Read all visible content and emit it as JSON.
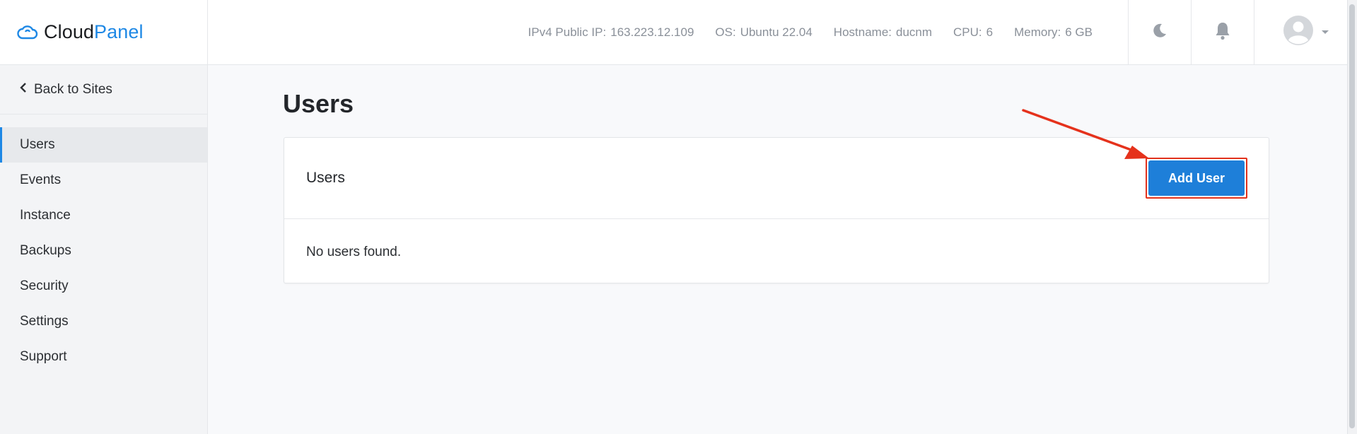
{
  "brand": {
    "name_part1": "Cloud",
    "name_part2": "Panel"
  },
  "server_info": [
    {
      "label": "IPv4 Public IP:",
      "value": "163.223.12.109"
    },
    {
      "label": "OS:",
      "value": "Ubuntu 22.04"
    },
    {
      "label": "Hostname:",
      "value": "ducnm"
    },
    {
      "label": "CPU:",
      "value": "6"
    },
    {
      "label": "Memory:",
      "value": "6 GB"
    }
  ],
  "header_icons": {
    "theme": "moon-icon",
    "notifications": "bell-icon",
    "avatar": "user-avatar"
  },
  "sidebar": {
    "back_label": "Back to Sites",
    "items": [
      {
        "label": "Users",
        "active": true
      },
      {
        "label": "Events",
        "active": false
      },
      {
        "label": "Instance",
        "active": false
      },
      {
        "label": "Backups",
        "active": false
      },
      {
        "label": "Security",
        "active": false
      },
      {
        "label": "Settings",
        "active": false
      },
      {
        "label": "Support",
        "active": false
      }
    ]
  },
  "main": {
    "page_title": "Users",
    "card_title": "Users",
    "add_button_label": "Add User",
    "empty_text": "No users found."
  },
  "colors": {
    "accent": "#1e88e5",
    "button": "#1e7fd9",
    "annotation": "#e5321c"
  }
}
